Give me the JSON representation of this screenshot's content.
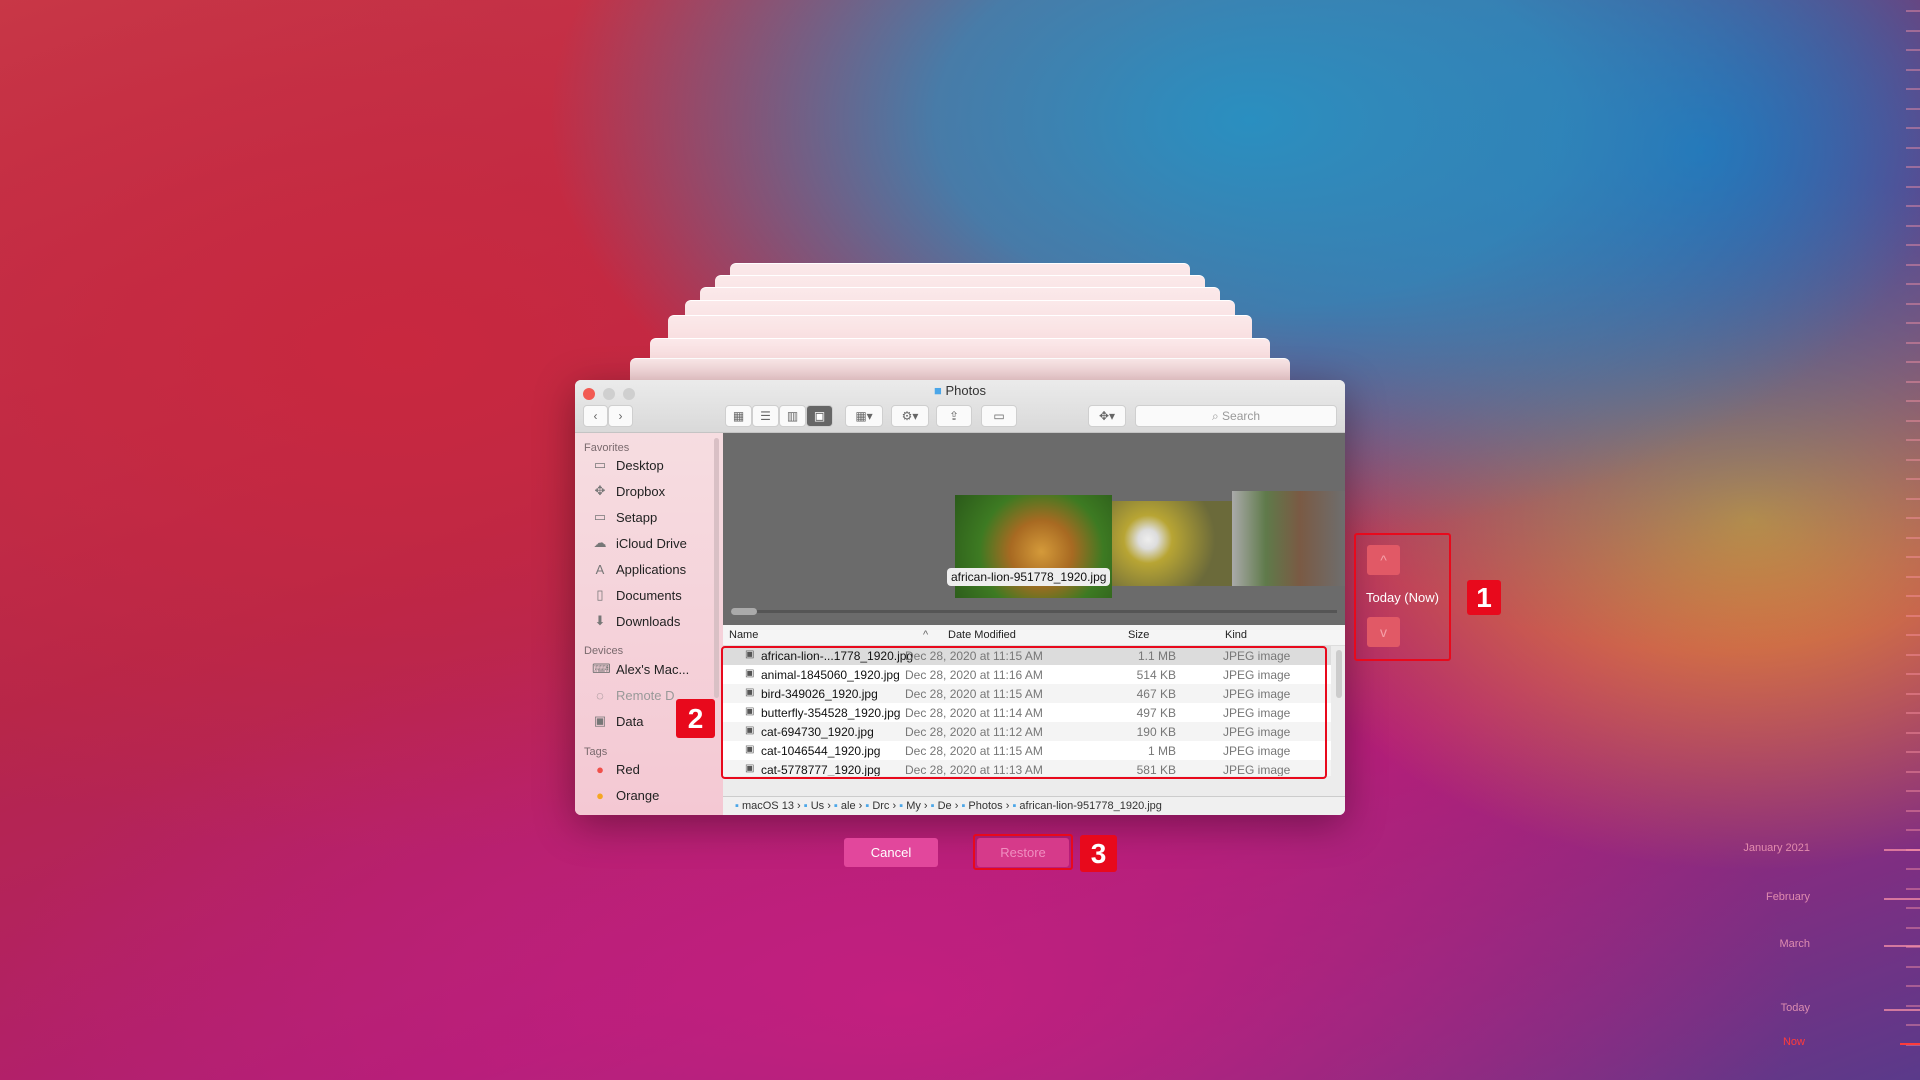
{
  "window": {
    "title": "Photos"
  },
  "toolbar": {
    "search_placeholder": "Search"
  },
  "sidebar": {
    "favorites_label": "Favorites",
    "favorites": [
      {
        "label": "Desktop",
        "icon": "folder-icon"
      },
      {
        "label": "Dropbox",
        "icon": "dropbox-icon"
      },
      {
        "label": "Setapp",
        "icon": "folder-icon"
      },
      {
        "label": "iCloud Drive",
        "icon": "cloud-icon"
      },
      {
        "label": "Applications",
        "icon": "applications-icon"
      },
      {
        "label": "Documents",
        "icon": "document-icon"
      },
      {
        "label": "Downloads",
        "icon": "download-icon"
      }
    ],
    "devices_label": "Devices",
    "devices": [
      {
        "label": "Alex's Mac..."
      },
      {
        "label": "Remote D"
      },
      {
        "label": "Data"
      }
    ],
    "tags_label": "Tags",
    "tags": [
      {
        "label": "Red",
        "color": "#f0504a"
      },
      {
        "label": "Orange",
        "color": "#f5a623"
      }
    ]
  },
  "preview": {
    "caption": "african-lion-951778_1920.jpg"
  },
  "columns": {
    "name": "Name",
    "date": "Date Modified",
    "size": "Size",
    "kind": "Kind"
  },
  "files": [
    {
      "name": "african-lion-...1778_1920.jpg",
      "date": "Dec 28, 2020 at 11:15 AM",
      "size": "1.1 MB",
      "kind": "JPEG image"
    },
    {
      "name": "animal-1845060_1920.jpg",
      "date": "Dec 28, 2020 at 11:16 AM",
      "size": "514 KB",
      "kind": "JPEG image"
    },
    {
      "name": "bird-349026_1920.jpg",
      "date": "Dec 28, 2020 at 11:15 AM",
      "size": "467 KB",
      "kind": "JPEG image"
    },
    {
      "name": "butterfly-354528_1920.jpg",
      "date": "Dec 28, 2020 at 11:14 AM",
      "size": "497 KB",
      "kind": "JPEG image"
    },
    {
      "name": "cat-694730_1920.jpg",
      "date": "Dec 28, 2020 at 11:12 AM",
      "size": "190 KB",
      "kind": "JPEG image"
    },
    {
      "name": "cat-1046544_1920.jpg",
      "date": "Dec 28, 2020 at 11:15 AM",
      "size": "1 MB",
      "kind": "JPEG image"
    },
    {
      "name": "cat-5778777_1920.jpg",
      "date": "Dec 28, 2020 at 11:13 AM",
      "size": "581 KB",
      "kind": "JPEG image"
    }
  ],
  "pathbar": [
    "macOS 13",
    "Us",
    "ale",
    "Drc",
    "My",
    "De",
    "Photos",
    "african-lion-951778_1920.jpg"
  ],
  "timemachine": {
    "current": "Today (Now)",
    "cancel": "Cancel",
    "restore": "Restore"
  },
  "badges": [
    "1",
    "2",
    "3"
  ],
  "timeline": [
    "January 2021",
    "February",
    "March",
    "Today",
    "Now"
  ],
  "colors": {
    "accent_red": "#e8091c",
    "cancel_button": "#e2479c"
  }
}
